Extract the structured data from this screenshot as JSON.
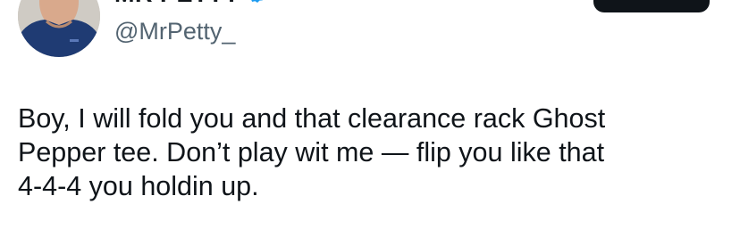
{
  "tweet": {
    "author": {
      "display_name": "MR PETTY",
      "handle": "@MrPetty_",
      "verified": true
    },
    "text_lines": [
      "Boy, I will fold you and that clearance rack Ghost",
      "Pepper tee. Don’t play wit me — flip you like that",
      "4-4-4 you holdin up."
    ]
  },
  "colors": {
    "text": "#0f1419",
    "secondary_text": "#536471",
    "verified_badge": "#1d9bf0",
    "button": "#0f1419"
  },
  "icons": {
    "verified": "verified-badge-icon",
    "avatar": "profile-photo"
  }
}
